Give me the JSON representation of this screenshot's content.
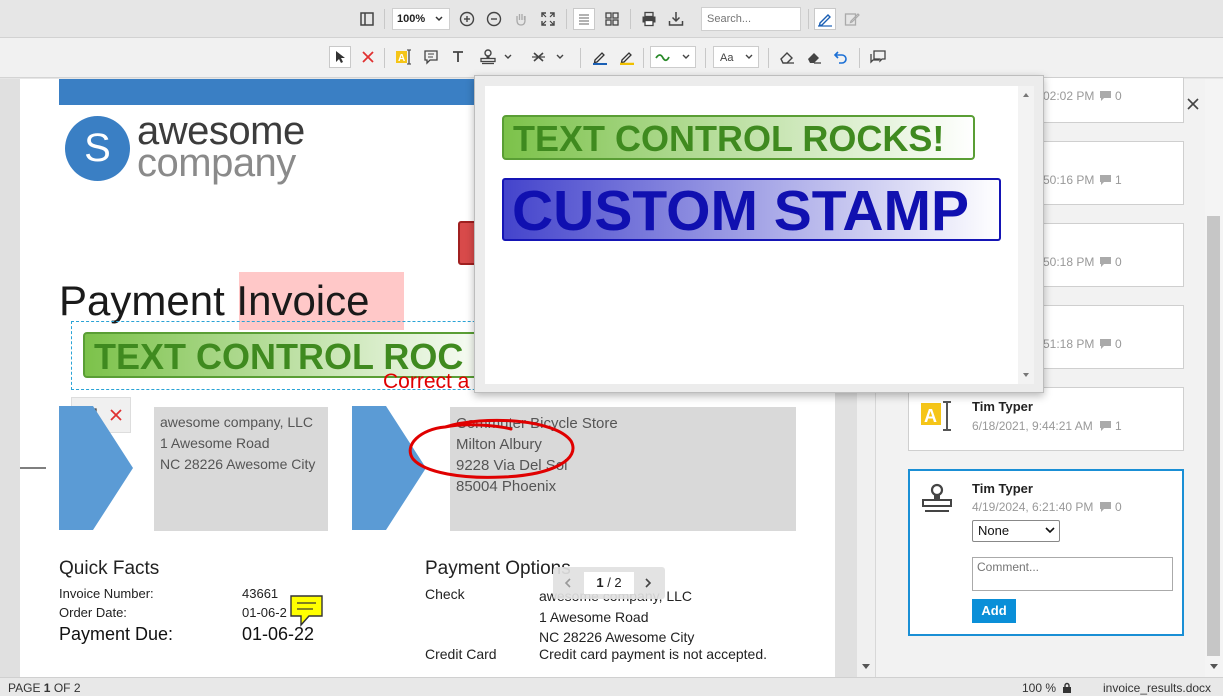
{
  "toolbar": {
    "zoom_value": "100%",
    "search_placeholder": "Search..."
  },
  "document": {
    "logo_line1": "awesome",
    "logo_line2": "company",
    "logo_initial": "S",
    "title_part1": "Payment ",
    "title_part2": "Invoice",
    "stamp_text": "TEXT CONTROL ROC",
    "annotation_text": "Correct a",
    "sender": [
      "awesome company, LLC",
      "1 Awesome Road",
      "NC 28226 Awesome City"
    ],
    "recipient": [
      "Commuter Bicycle Store",
      "Milton Albury",
      "9228 Via Del Sol",
      "85004 Phoenix"
    ],
    "quick_facts_title": "Quick Facts",
    "invoice_number_label": "Invoice Number:",
    "invoice_number_value": "43661",
    "order_date_label": "Order Date:",
    "order_date_value": "01-06-2",
    "payment_due_label": "Payment Due:",
    "payment_due_value": "01-06-22",
    "payment_options_title": "Payment Options",
    "check_label": "Check",
    "check_lines": [
      "awesome company, LLC",
      "1 Awesome Road",
      "NC 28226 Awesome City"
    ],
    "credit_card_label": "Credit Card",
    "credit_card_value": "Credit card payment is not accepted."
  },
  "page_nav": {
    "current": "1",
    "separator": " / ",
    "total": "2"
  },
  "stamp_popup": {
    "stamp1": "TEXT CONTROL ROCKS!",
    "stamp2": "CUSTOM STAMP"
  },
  "comments": [
    {
      "date": "02:02 PM",
      "count": "0"
    },
    {
      "date": "50:16 PM",
      "count": "1"
    },
    {
      "date": "50:18 PM",
      "count": "0"
    },
    {
      "date": "51:18 PM",
      "count": "0"
    },
    {
      "author": "Tim Typer",
      "date": "6/18/2021, 9:44:21 AM",
      "count": "1"
    },
    {
      "author": "Tim Typer",
      "date": "4/19/2024, 6:21:40 PM",
      "count": "0",
      "status": "None",
      "comment_placeholder": "Comment...",
      "add_label": "Add"
    }
  ],
  "status_bar": {
    "page_prefix": "PAGE ",
    "page_current": "1",
    "page_suffix": " OF 2",
    "zoom": "100 %",
    "filename": "invoice_results.docx"
  },
  "colors": {
    "accent": "#1a8fd5",
    "logo_blue": "#3a7fc4",
    "stamp_green": "#5a9e35",
    "stamp_blue": "#1010b0",
    "ink_red": "#e00000",
    "highlight_pink": "#ffc8c8"
  }
}
